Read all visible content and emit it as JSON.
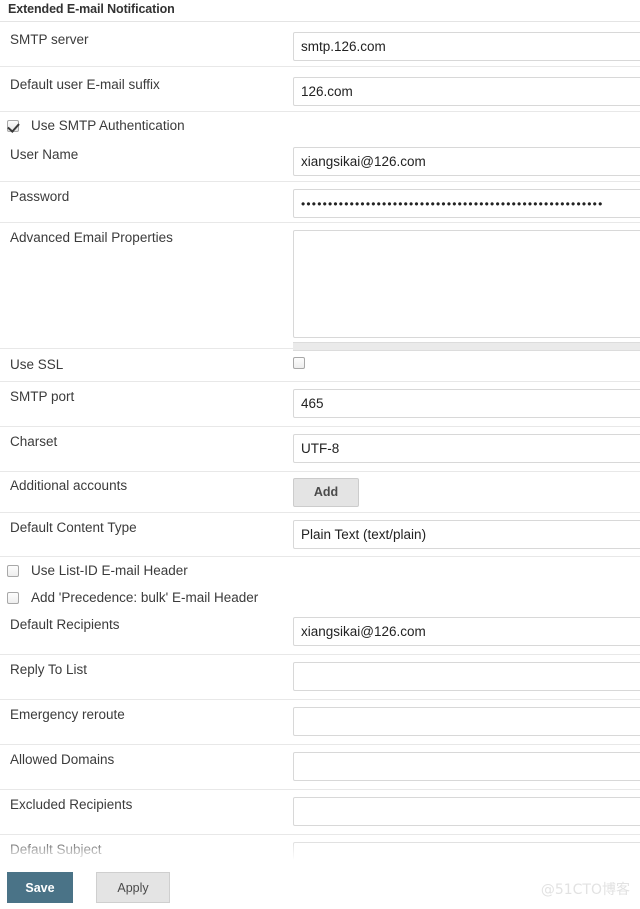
{
  "section": {
    "title": "Extended E-mail Notification"
  },
  "fields": {
    "smtp_server": {
      "label": "SMTP server",
      "value": "smtp.126.com"
    },
    "email_suffix": {
      "label": "Default user E-mail suffix",
      "value": "126.com"
    },
    "use_smtp_auth": {
      "label": "Use SMTP Authentication",
      "checked": true
    },
    "user_name": {
      "label": "User Name",
      "value": "xiangsikai@126.com"
    },
    "password": {
      "label": "Password",
      "value": "••••••••••••••••••••••••••••••••••••••••••••••••••••••••"
    },
    "advanced_props": {
      "label": "Advanced Email Properties",
      "value": ""
    },
    "use_ssl": {
      "label": "Use SSL",
      "checked": false
    },
    "smtp_port": {
      "label": "SMTP port",
      "value": "465"
    },
    "charset": {
      "label": "Charset",
      "value": "UTF-8"
    },
    "additional_accounts": {
      "label": "Additional accounts",
      "button": "Add"
    },
    "default_content_type": {
      "label": "Default Content Type",
      "value": "Plain Text (text/plain)"
    },
    "use_listid_header": {
      "label": "Use List-ID E-mail Header",
      "checked": false
    },
    "precedence_bulk_header": {
      "label": "Add 'Precedence: bulk' E-mail Header",
      "checked": false
    },
    "default_recipients": {
      "label": "Default Recipients",
      "value": "xiangsikai@126.com"
    },
    "reply_to_list": {
      "label": "Reply To List",
      "value": ""
    },
    "emergency_reroute": {
      "label": "Emergency reroute",
      "value": ""
    },
    "allowed_domains": {
      "label": "Allowed Domains",
      "value": ""
    },
    "excluded_recipients": {
      "label": "Excluded Recipients",
      "value": ""
    },
    "default_subject": {
      "label": "Default Subject",
      "value": ""
    }
  },
  "footer": {
    "save_label": "Save",
    "apply_label": "Apply",
    "watermark": "@51CTO博客"
  },
  "colors": {
    "save_button": "#4a7387",
    "apply_button": "#e4e4e4",
    "border": "#d8d8d8",
    "label_text": "#3b3b3b"
  }
}
